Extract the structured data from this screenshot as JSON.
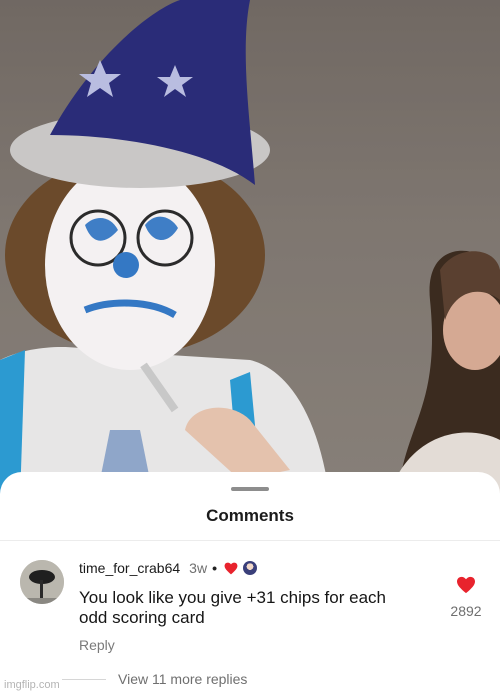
{
  "sheet": {
    "title": "Comments"
  },
  "comment": {
    "username": "time_for_crab64",
    "time": "3w",
    "separator": "•",
    "text": "You look like you give +31 chips for each odd scoring card",
    "reply_label": "Reply",
    "like_count": "2892",
    "liked": true,
    "heart_color": "#e8232d"
  },
  "replies": {
    "view_more_label": "View 11 more replies"
  },
  "watermark": {
    "text": "imgflip.com"
  },
  "icons": {
    "like": "heart-icon",
    "creator_like": "heart-small-icon",
    "creator_avatar": "creator-mini-avatar"
  }
}
